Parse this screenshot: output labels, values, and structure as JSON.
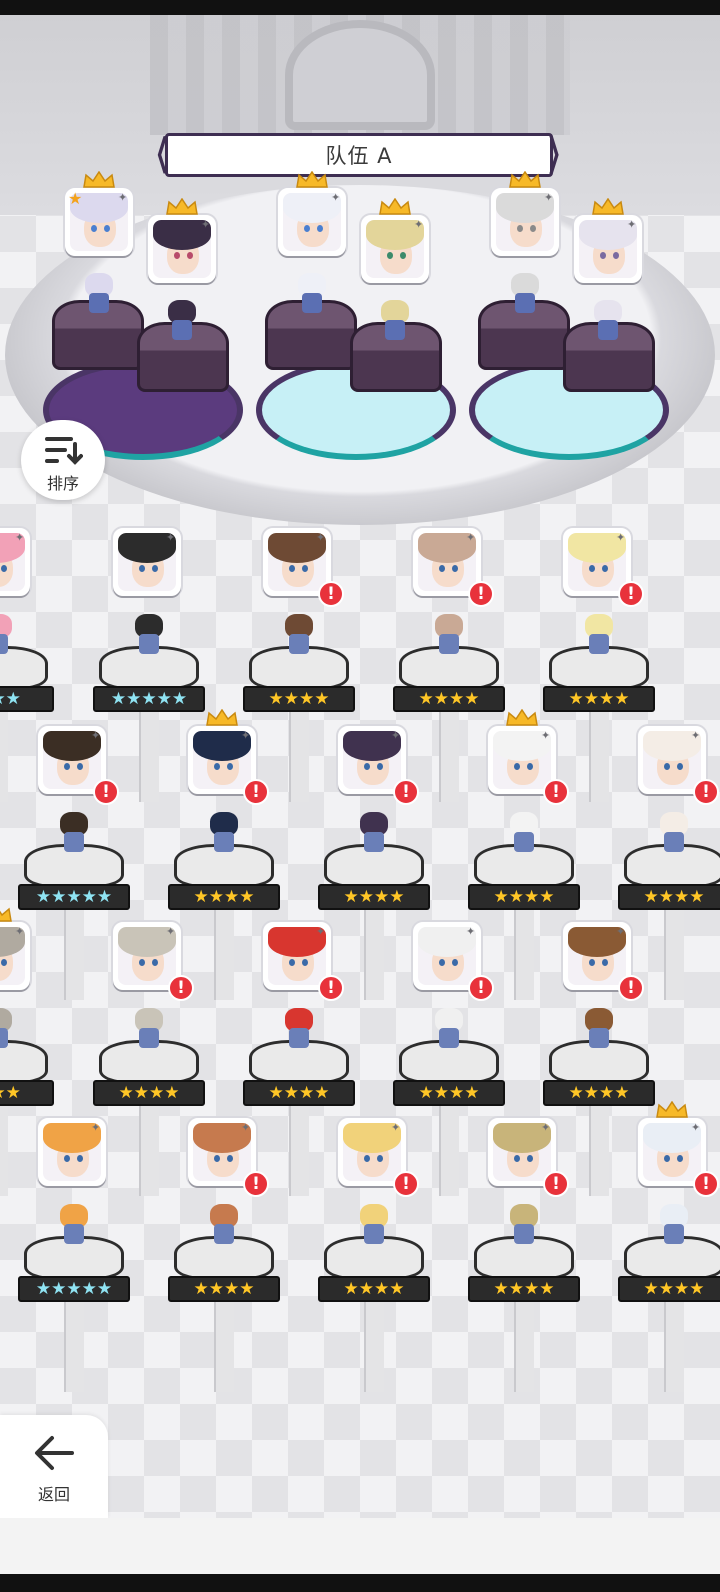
{
  "team": {
    "name": "队伍 A"
  },
  "buttons": {
    "sort_label": "排序",
    "back_label": "返回"
  },
  "team_slots": [
    {
      "pos": 1,
      "crown": true,
      "star_badge": true,
      "hair": "#dcd9ee",
      "eyes": "#4a7fd0"
    },
    {
      "pos": 2,
      "crown": true,
      "star_badge": false,
      "hair": "#3a2e46",
      "eyes": "#b84b6a"
    },
    {
      "pos": 3,
      "crown": true,
      "star_badge": false,
      "hair": "#eef0f7",
      "eyes": "#4a7fd0"
    },
    {
      "pos": 4,
      "crown": true,
      "star_badge": false,
      "hair": "#e3d59a",
      "eyes": "#3c8a6b"
    },
    {
      "pos": 5,
      "crown": true,
      "star_badge": false,
      "hair": "#dadada",
      "eyes": "#8a8a8a"
    },
    {
      "pos": 6,
      "crown": true,
      "star_badge": false,
      "hair": "#e6e3ee",
      "eyes": "#7a6aa0"
    }
  ],
  "roster": [
    {
      "hair": "#f2a1b7",
      "crown": false,
      "alert": false,
      "stars": "★★★",
      "five": true
    },
    {
      "hair": "#2c2c2c",
      "crown": false,
      "alert": false,
      "stars": "★★★★★",
      "five": true
    },
    {
      "hair": "#6e4a34",
      "crown": false,
      "alert": true,
      "stars": "★★★★",
      "five": false
    },
    {
      "hair": "#c9a995",
      "crown": false,
      "alert": true,
      "stars": "★★★★",
      "five": false
    },
    {
      "hair": "#f1e6a3",
      "crown": false,
      "alert": true,
      "stars": "★★★★",
      "five": false
    },
    {
      "hair": "#3b2e24",
      "crown": false,
      "alert": true,
      "stars": "★★★★★",
      "five": true
    },
    {
      "hair": "#1f2c4a",
      "crown": true,
      "alert": true,
      "stars": "★★★★",
      "five": false
    },
    {
      "hair": "#40324f",
      "crown": false,
      "alert": true,
      "stars": "★★★★",
      "five": false
    },
    {
      "hair": "#f3f3f3",
      "crown": true,
      "alert": true,
      "stars": "★★★★",
      "five": false
    },
    {
      "hair": "#f4ede6",
      "crown": false,
      "alert": true,
      "stars": "★★★★",
      "five": false
    },
    {
      "hair": "#b0aaa0",
      "crown": true,
      "alert": false,
      "stars": "★★★",
      "five": false
    },
    {
      "hair": "#c9c4b8",
      "crown": false,
      "alert": true,
      "stars": "★★★★",
      "five": false
    },
    {
      "hair": "#d8362f",
      "crown": false,
      "alert": true,
      "stars": "★★★★",
      "five": false
    },
    {
      "hair": "#f0f0f0",
      "crown": false,
      "alert": true,
      "stars": "★★★★",
      "five": false
    },
    {
      "hair": "#8a5a34",
      "crown": false,
      "alert": true,
      "stars": "★★★★",
      "five": false
    },
    {
      "hair": "#f0a346",
      "crown": false,
      "alert": false,
      "stars": "★★★★★",
      "five": true
    },
    {
      "hair": "#c67a4e",
      "crown": false,
      "alert": true,
      "stars": "★★★★",
      "five": false
    },
    {
      "hair": "#f1d27a",
      "crown": false,
      "alert": true,
      "stars": "★★★★",
      "five": false
    },
    {
      "hair": "#c8b47a",
      "crown": false,
      "alert": true,
      "stars": "★★★★",
      "five": false
    },
    {
      "hair": "#e9eef5",
      "crown": true,
      "alert": true,
      "stars": "★★★★",
      "five": false
    }
  ],
  "colors": {
    "accent": "#3e2e52",
    "alert": "#e8323b",
    "star": "#ffc626",
    "star_five": "#8fe3f2"
  }
}
